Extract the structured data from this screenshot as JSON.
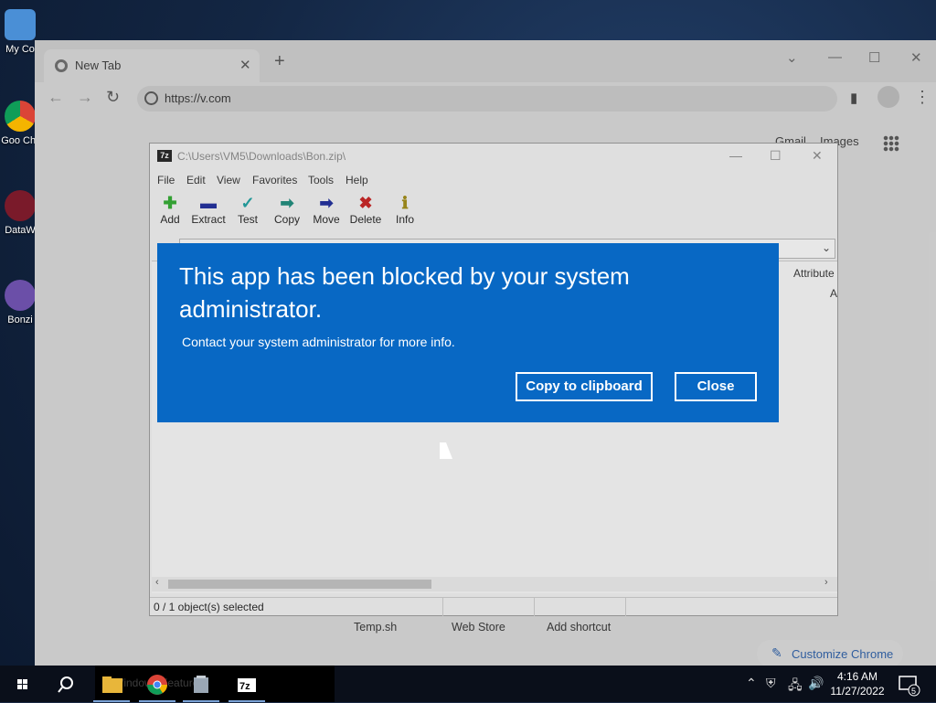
{
  "desktop": {
    "icons": [
      {
        "label": "My Co"
      },
      {
        "label": "Goo Chr"
      },
      {
        "label": "DataW"
      },
      {
        "label": "Bonzi"
      }
    ]
  },
  "browser": {
    "tab_title": "New Tab",
    "url": "https://v.com",
    "links": {
      "gmail": "Gmail",
      "images": "Images"
    },
    "shortcuts": [
      "Temp.sh",
      "Web Store",
      "Add shortcut"
    ],
    "customize_label": "Customize Chrome"
  },
  "sevenzip": {
    "title": "C:\\Users\\VM5\\Downloads\\Bon.zip\\",
    "menu": [
      "File",
      "Edit",
      "View",
      "Favorites",
      "Tools",
      "Help"
    ],
    "toolbar": [
      "Add",
      "Extract",
      "Test",
      "Copy",
      "Move",
      "Delete",
      "Info"
    ],
    "column_header": "Attribute",
    "column_value": "A",
    "status": "0 / 1 object(s) selected"
  },
  "dialog": {
    "heading": "This app has been blocked by your system administrator.",
    "message": "Contact your system administrator for more info.",
    "copy_button": "Copy to clipboard",
    "close_button": "Close"
  },
  "taskbar": {
    "search_ghost": "Windows Features",
    "time": "4:16 AM",
    "date": "11/27/2022",
    "notification_count": "5"
  },
  "colors": {
    "dialog_blue": "#0868c4",
    "taskbar": "#0a0f1a"
  }
}
